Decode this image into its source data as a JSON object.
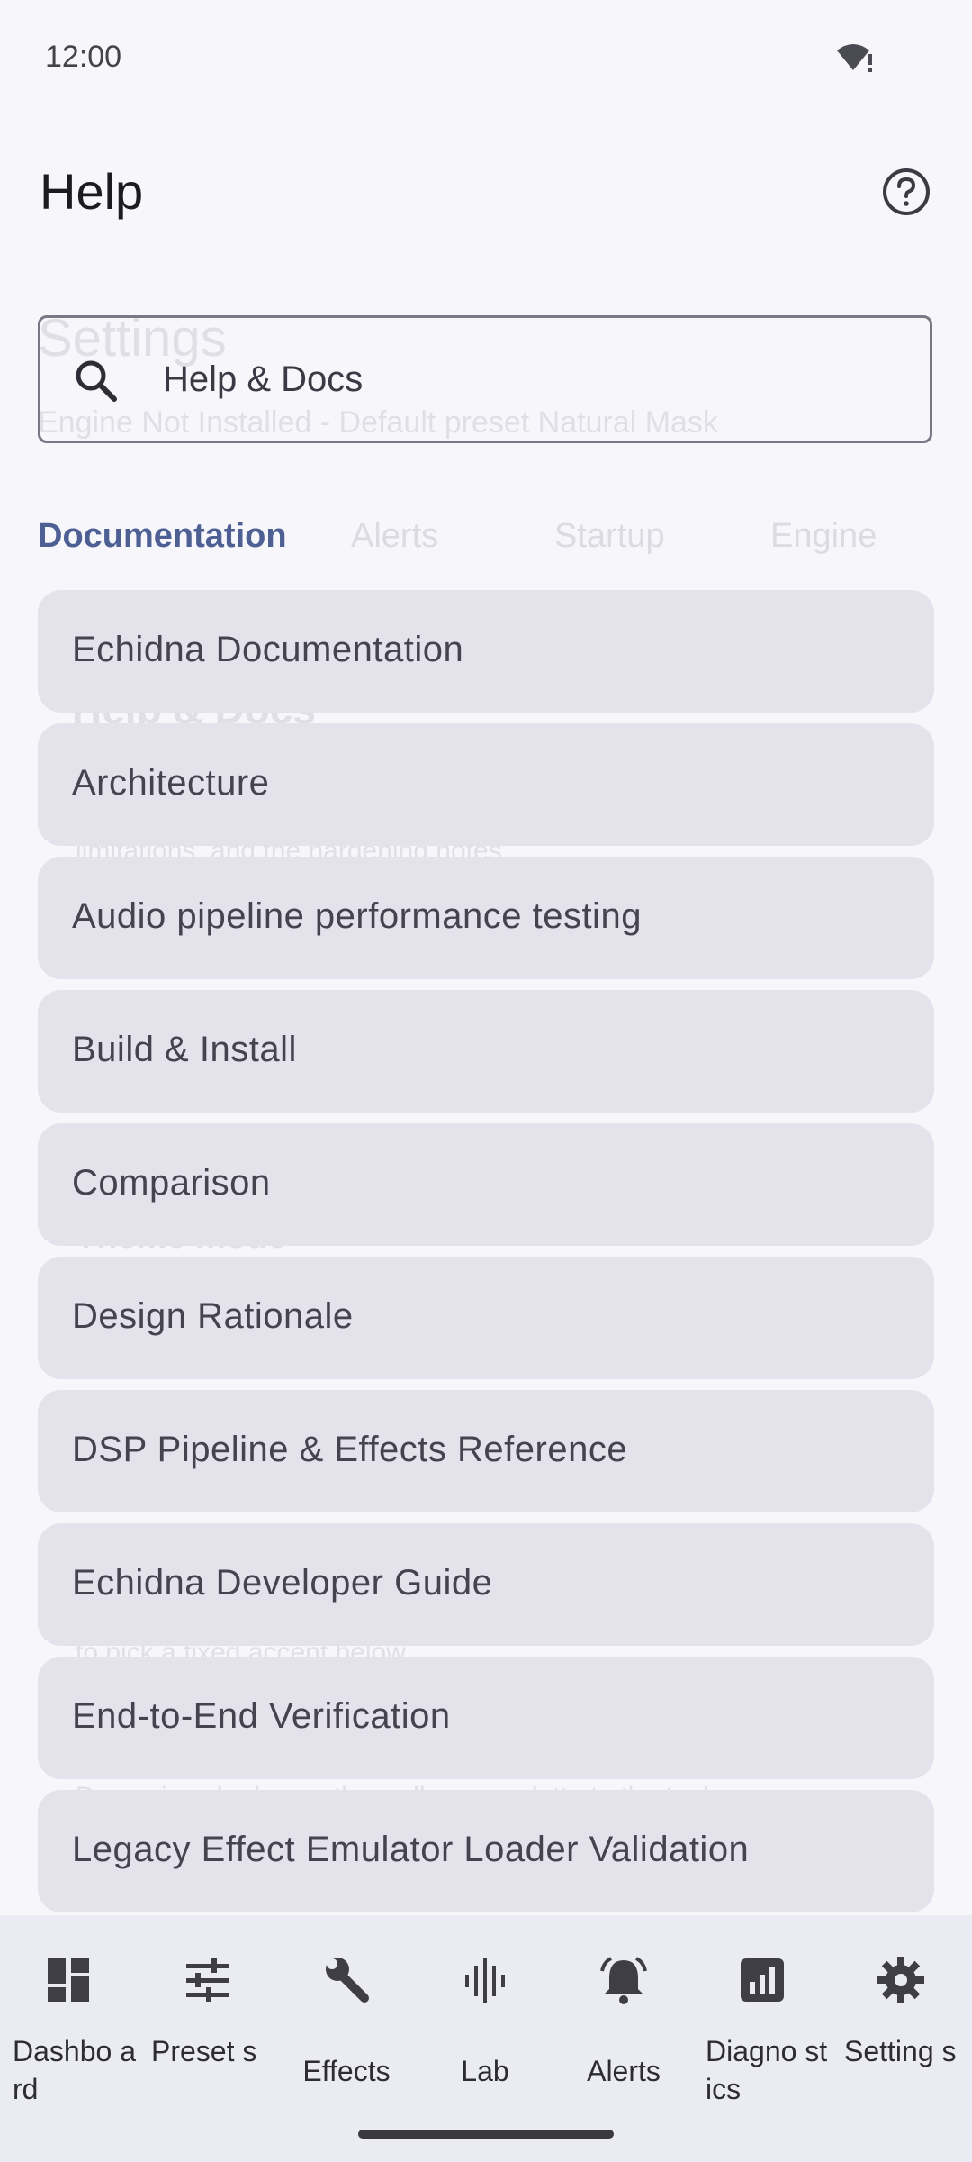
{
  "status_bar": {
    "time": "12:00",
    "icons": [
      "wifi-alert-icon"
    ]
  },
  "header": {
    "title": "Help",
    "help_icon": "help-circle-icon"
  },
  "background_ghost": {
    "settings_title": "Settings",
    "engine_status": "Engine Not Installed - Default preset Natural Mask",
    "help_docs": "Help & Docs",
    "limitations": "limitations, and the hardening notes",
    "theme_mode": "Theme mode",
    "accent_note": "to pick a fixed accent below",
    "dynamic_note": "Dynamic color keeps the wallpaper palette to the tool",
    "tabs": [
      "Alerts",
      "Startup",
      "Engine"
    ]
  },
  "search": {
    "value": "Help & Docs",
    "icon": "search-icon"
  },
  "tabs": {
    "active": "Documentation"
  },
  "docs": [
    {
      "label": "Echidna Documentation"
    },
    {
      "label": "Architecture"
    },
    {
      "label": "Audio pipeline performance testing"
    },
    {
      "label": "Build & Install"
    },
    {
      "label": "Comparison"
    },
    {
      "label": "Design Rationale"
    },
    {
      "label": "DSP Pipeline & Effects Reference"
    },
    {
      "label": "Echidna Developer Guide"
    },
    {
      "label": "End-to-End Verification"
    },
    {
      "label": "Legacy Effect Emulator Loader Validation"
    }
  ],
  "bottom_nav": [
    {
      "label": "Dashbo ard",
      "icon": "dashboard-icon"
    },
    {
      "label": "Preset s",
      "icon": "tune-icon"
    },
    {
      "label": "Effects",
      "icon": "wrench-icon"
    },
    {
      "label": "Lab",
      "icon": "waveform-icon"
    },
    {
      "label": "Alerts",
      "icon": "bell-icon"
    },
    {
      "label": "Diagno stics",
      "icon": "bar-chart-icon"
    },
    {
      "label": "Setting s",
      "icon": "gear-icon"
    }
  ],
  "colors": {
    "accent": "#4d5f93",
    "card": "#e4e3ec",
    "nav_bg": "#ebebf3",
    "background": "#f7f6fb"
  }
}
